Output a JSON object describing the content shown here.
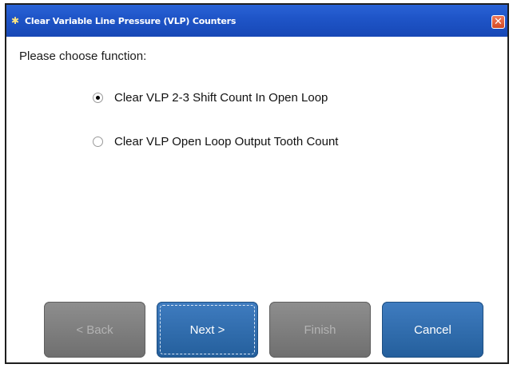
{
  "window": {
    "title": "Clear Variable Line Pressure (VLP) Counters",
    "title_icon": "star-icon",
    "close_glyph": "✕"
  },
  "prompt": "Please choose function:",
  "options": [
    {
      "label": "Clear VLP 2-3 Shift Count In Open Loop",
      "selected": true
    },
    {
      "label": "Clear VLP Open Loop Output Tooth Count",
      "selected": false
    }
  ],
  "buttons": {
    "back": "< Back",
    "next": "Next >",
    "finish": "Finish",
    "cancel": "Cancel"
  },
  "colors": {
    "titlebar": "#1f55c8",
    "primary_button": "#2f6dab",
    "disabled_button": "#7d7d7d"
  }
}
